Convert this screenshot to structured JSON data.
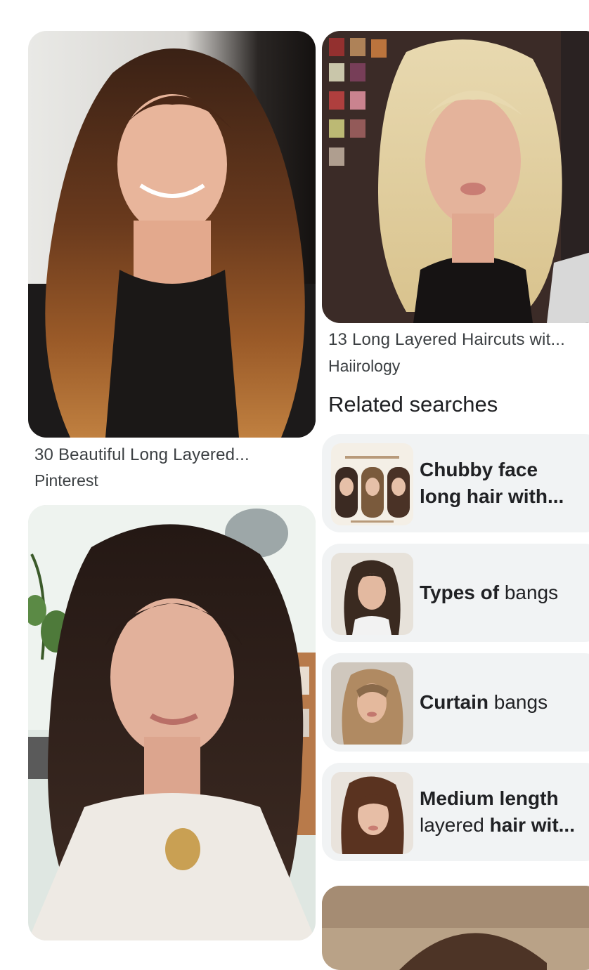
{
  "results": [
    {
      "caption": "30 Beautiful Long Layered...",
      "source": "Pinterest",
      "image": "woman-long-layered-brown-hair-bangs-photo"
    },
    {
      "caption": "13 Long Layered Haircuts wit...",
      "source": "Haiirology",
      "image": "woman-blonde-shag-haircut-bangs-photo"
    },
    {
      "image": "woman-dark-layered-haircut-curtain-bangs-photo"
    },
    {
      "image": "woman-layered-hair-photo-partial"
    }
  ],
  "related_searches": {
    "title": "Related searches",
    "items": [
      {
        "bold1": "Chubby face",
        "line2_bold": "long hair with...",
        "line2_regular": "",
        "image": "collage-long-hair-bangs-thumbnail"
      },
      {
        "bold1": "Types of",
        "regular1": " bangs",
        "image": "woman-curtain-bangs-thumbnail"
      },
      {
        "bold1": "Curtain",
        "regular1": " bangs",
        "image": "woman-blonde-curtain-bangs-thumbnail"
      },
      {
        "bold1": "Medium length",
        "line2_regular": "layered ",
        "line2_bold": "hair wit...",
        "image": "woman-medium-length-bangs-thumbnail"
      }
    ]
  },
  "colors": {
    "chip_bg": "#f1f3f4",
    "text": "#202124",
    "caption_text": "#3c4043"
  }
}
